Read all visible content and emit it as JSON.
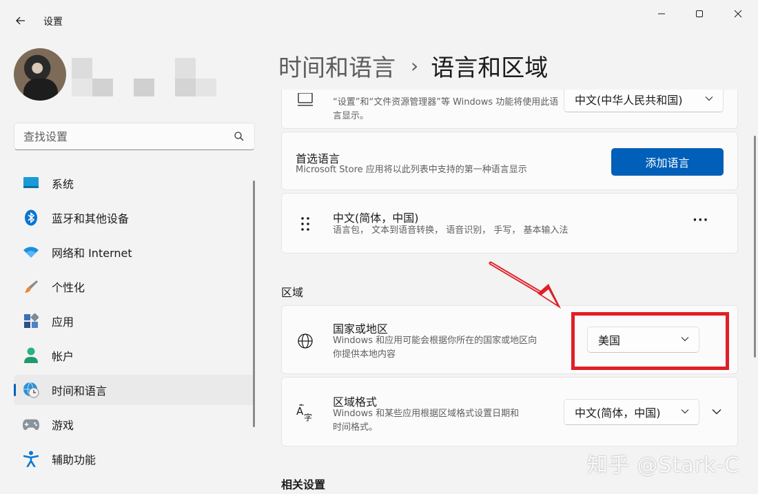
{
  "app": {
    "title": "设置"
  },
  "search": {
    "placeholder": "查找设置"
  },
  "nav": {
    "items": [
      {
        "label": "系统",
        "icon": "monitor-icon"
      },
      {
        "label": "蓝牙和其他设备",
        "icon": "bluetooth-icon"
      },
      {
        "label": "网络和 Internet",
        "icon": "wifi-icon"
      },
      {
        "label": "个性化",
        "icon": "paintbrush-icon"
      },
      {
        "label": "应用",
        "icon": "apps-icon"
      },
      {
        "label": "帐户",
        "icon": "person-icon"
      },
      {
        "label": "时间和语言",
        "icon": "globe-clock-icon",
        "active": true
      },
      {
        "label": "游戏",
        "icon": "gamepad-icon"
      },
      {
        "label": "辅助功能",
        "icon": "accessibility-icon"
      }
    ]
  },
  "breadcrumb": {
    "parent": "时间和语言",
    "separator": "›",
    "current": "语言和区域"
  },
  "display_language": {
    "desc": "“设置”和“文件资源管理器”等 Windows 功能将使用此语言显示。",
    "value": "中文(中华人民共和国)"
  },
  "preferred_language": {
    "title": "首选语言",
    "desc": "Microsoft Store 应用将以此列表中支持的第一种语言显示",
    "button": "添加语言"
  },
  "language_item": {
    "title": "中文(简体，中国)",
    "desc": "语言包， 文本到语音转换， 语音识别， 手写， 基本输入法",
    "more": "···"
  },
  "region_section": {
    "label": "区域"
  },
  "country": {
    "title": "国家或地区",
    "desc_line1": "Windows 和应用可能会根据你所在的国家或地区向",
    "desc_line2": "你提供本地内容",
    "value": "美国"
  },
  "regional_format": {
    "title": "区域格式",
    "desc_line1": "Windows 和某些应用根据区域格式设置日期和",
    "desc_line2": "时间格式。",
    "value": "中文(简体，中国)"
  },
  "related_section": {
    "label": "相关设置"
  },
  "watermark": {
    "text": "知乎 @Stark-C"
  },
  "colors": {
    "accent": "#005fb8",
    "annotation": "#e01f26"
  }
}
